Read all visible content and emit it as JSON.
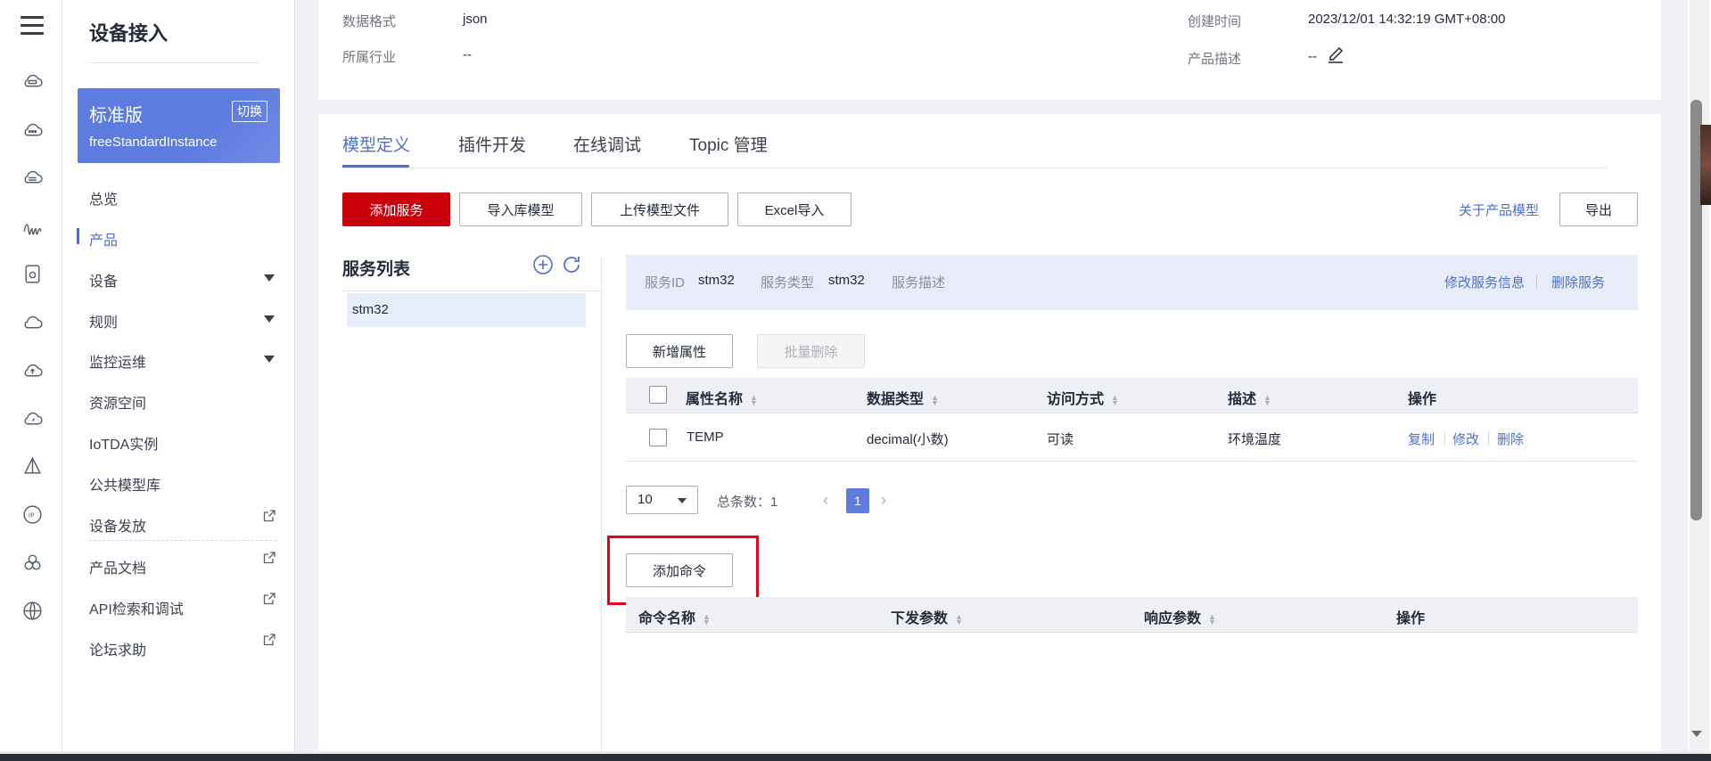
{
  "sidebar": {
    "title": "设备接入",
    "edition": {
      "name": "标准版",
      "switch_label": "切换",
      "instance": "freeStandardInstance"
    },
    "items": [
      {
        "label": "总览"
      },
      {
        "label": "产品"
      },
      {
        "label": "设备"
      },
      {
        "label": "规则"
      },
      {
        "label": "监控运维"
      },
      {
        "label": "资源空间"
      },
      {
        "label": "IoTDA实例"
      },
      {
        "label": "公共模型库"
      },
      {
        "label": "设备发放"
      },
      {
        "label": "产品文档"
      },
      {
        "label": "API检索和调试"
      },
      {
        "label": "论坛求助"
      }
    ],
    "active_item": "产品"
  },
  "product_info": {
    "data_format_label": "数据格式",
    "data_format_value": "json",
    "industry_label": "所属行业",
    "industry_value": "--",
    "created_label": "创建时间",
    "created_value": "2023/12/01 14:32:19 GMT+08:00",
    "desc_label": "产品描述",
    "desc_value": "--"
  },
  "tabs": [
    {
      "label": "模型定义"
    },
    {
      "label": "插件开发"
    },
    {
      "label": "在线调试"
    },
    {
      "label": "Topic 管理"
    }
  ],
  "toolbar": {
    "add_service": "添加服务",
    "import_library": "导入库模型",
    "upload_model": "上传模型文件",
    "excel_import": "Excel导入",
    "about_model": "关于产品模型",
    "export": "导出"
  },
  "service_list": {
    "title": "服务列表",
    "items": [
      "stm32"
    ]
  },
  "service_info": {
    "id_label": "服务ID",
    "id_value": "stm32",
    "type_label": "服务类型",
    "type_value": "stm32",
    "desc_label": "服务描述",
    "edit_link": "修改服务信息",
    "delete_link": "删除服务"
  },
  "properties": {
    "add_button": "新增属性",
    "batch_delete_button": "批量删除",
    "columns": [
      "属性名称",
      "数据类型",
      "访问方式",
      "描述",
      "操作"
    ],
    "rows": [
      {
        "name": "TEMP",
        "type": "decimal(小数)",
        "access": "可读",
        "desc": "环境温度",
        "ops": [
          "复制",
          "修改",
          "删除"
        ]
      }
    ]
  },
  "pagination": {
    "page_size": "10",
    "total": "总条数：1",
    "current_page": "1"
  },
  "commands": {
    "add_button": "添加命令",
    "columns": [
      "命令名称",
      "下发参数",
      "响应参数",
      "操作"
    ]
  },
  "colors": {
    "primary": "#526ecc",
    "danger": "#c7000b",
    "highlight": "#e5001b"
  }
}
